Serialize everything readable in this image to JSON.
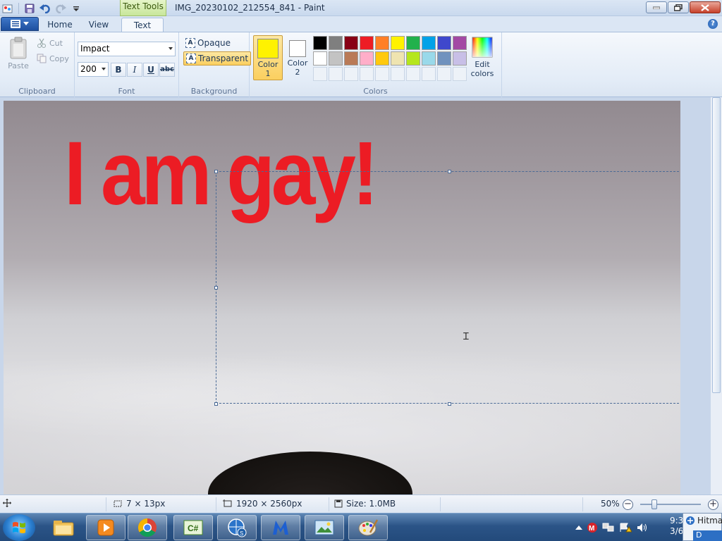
{
  "window": {
    "title": "IMG_20230102_212554_841 - Paint",
    "context_tab": "Text Tools"
  },
  "tabs": [
    {
      "label": "Home"
    },
    {
      "label": "View"
    },
    {
      "label": "Text"
    }
  ],
  "ribbon": {
    "clipboard": {
      "label": "Clipboard",
      "paste": "Paste",
      "cut": "Cut",
      "copy": "Copy"
    },
    "font": {
      "label": "Font",
      "family": "Impact",
      "size": "200",
      "bold": "B",
      "italic": "I",
      "underline": "U",
      "strike": "abc"
    },
    "background": {
      "label": "Background",
      "opaque": "Opaque",
      "transparent": "Transparent"
    },
    "colors": {
      "label": "Colors",
      "color1_label": "Color 1",
      "color2_label": "Color 2",
      "edit_colors": "Edit colors",
      "color1": "#fff200",
      "color2": "#ffffff",
      "palette_row1": [
        "#000000",
        "#7f7f7f",
        "#880015",
        "#ed1c24",
        "#ff7f27",
        "#fff200",
        "#22b14c",
        "#00a2e8",
        "#3f48cc",
        "#a349a4"
      ],
      "palette_row2": [
        "#ffffff",
        "#c3c3c3",
        "#b97a57",
        "#ffaec9",
        "#ffc90e",
        "#efe4b0",
        "#b5e61d",
        "#99d9ea",
        "#7092be",
        "#c8bfe7"
      ]
    }
  },
  "canvas": {
    "text": "I am gay!",
    "text_color": "#ec1c24"
  },
  "statusbar": {
    "selection_size": "7 × 13px",
    "image_size": "1920 × 2560px",
    "file_size": "Size: 1.0MB",
    "zoom": "50%"
  },
  "taskbar": {
    "clock_line1": "9:3",
    "clock_line2": "3/6",
    "notification_title": "Hitma",
    "notification_button": "D"
  }
}
